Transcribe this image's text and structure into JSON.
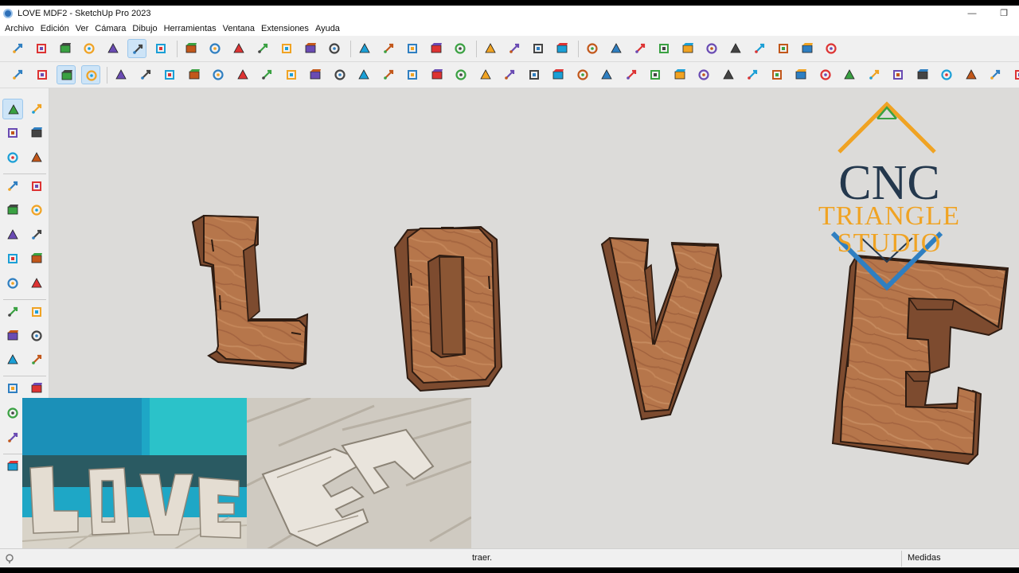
{
  "window": {
    "title": "LOVE MDF2 - SketchUp Pro 2023",
    "minimize_glyph": "—",
    "restore_glyph": "❐"
  },
  "menu": [
    "Archivo",
    "Edición",
    "Ver",
    "Cámara",
    "Dibujo",
    "Herramientas",
    "Ventana",
    "Extensiones",
    "Ayuda"
  ],
  "toolbar1_icons": [
    "component-cube-icon",
    "eraser-cube-icon",
    "wireframe-cube-icon",
    "hidden-line-icon",
    "shaded-icon",
    "textured-icon",
    "monochrome-icon",
    "iso-view-icon",
    "top-view-icon",
    "front-view-icon",
    "right-view-icon",
    "back-view-icon",
    "left-view-icon",
    "group-icon",
    "outer-shell-icon",
    "intersect-icon",
    "union-icon",
    "subtract-icon",
    "trim-icon",
    "split-icon",
    "warehouse-icon",
    "extension-warehouse-icon",
    "layout-icon",
    "model-info-icon",
    "styles-icon",
    "tags-icon",
    "components-icon",
    "materials-icon",
    "scenes-icon",
    "shadows-icon",
    "undo-icon",
    "redo-icon",
    "paint-icon",
    "sandbox-icon"
  ],
  "toolbar2_icons": [
    "move-axes-icon",
    "solid-tools-icon",
    "section-plane-icon",
    "section-cut-icon",
    "push-pull-icon",
    "follow-me-icon",
    "offset-icon",
    "scale-icon",
    "rotate-icon",
    "flip-icon",
    "tape-icon",
    "protractor-icon",
    "text-icon",
    "axes-icon",
    "dimension-icon",
    "label-icon",
    "measure-icon",
    "orbit-icon",
    "pan-icon",
    "zoom-icon",
    "zoom-window-icon",
    "zoom-extents-icon",
    "previous-view-icon",
    "next-view-icon",
    "walk-icon",
    "look-around-icon",
    "position-camera-icon",
    "arc-icon",
    "circle-icon",
    "polygon-icon",
    "freehand-icon",
    "rectangle-icon",
    "line-icon",
    "select-icon",
    "paint-bucket-icon",
    "eraser-icon",
    "tape-measure-icon",
    "stamp-icon",
    "drape-icon",
    "smoove-icon",
    "flip-edge-icon",
    "add-detail-icon",
    "from-contours-icon",
    "from-scratch-icon",
    "components-browser-icon"
  ],
  "palette_icons": [
    "select-icon",
    "orbit-icon",
    "paint-bucket-icon",
    "eraser-icon",
    "make-component-icon",
    "tape-measure-icon",
    "pencil-icon",
    "freehand-icon",
    "rectangle-icon",
    "rotated-rectangle-icon",
    "circle-icon",
    "polygon-icon",
    "arc-icon",
    "two-point-arc-icon",
    "three-point-arc-icon",
    "pie-icon",
    "move-icon",
    "push-pull-icon",
    "rotate-icon",
    "follow-me-icon",
    "scale-icon",
    "offset-icon",
    "axes-icon",
    "outer-shell-icon",
    "tape-icon",
    "protractor-icon",
    "pan-icon",
    "walk-icon",
    "zoom-icon",
    "zoom-extents-icon"
  ],
  "logo": {
    "line1": "CNC",
    "line2": "TRIANGLE STUDIO",
    "colors": {
      "orange": "#f0a323",
      "navy": "#24384d",
      "blue": "#2f7fc1",
      "green": "#3aa142"
    }
  },
  "model": {
    "letters": [
      "L",
      "O",
      "V",
      "E"
    ],
    "wood_face": "#b6764b",
    "wood_side": "#7d4b2f",
    "edge": "#2e1c12"
  },
  "status": {
    "text": "traer.",
    "measure_label": "Medidas",
    "measure_value": ""
  },
  "colors": {
    "viewport_bg": "#dcdbd9",
    "toolbar_bg": "#f0f0f0",
    "active_highlight": "#cde4f7",
    "photo_wall_teal": "#2bc2c9"
  }
}
